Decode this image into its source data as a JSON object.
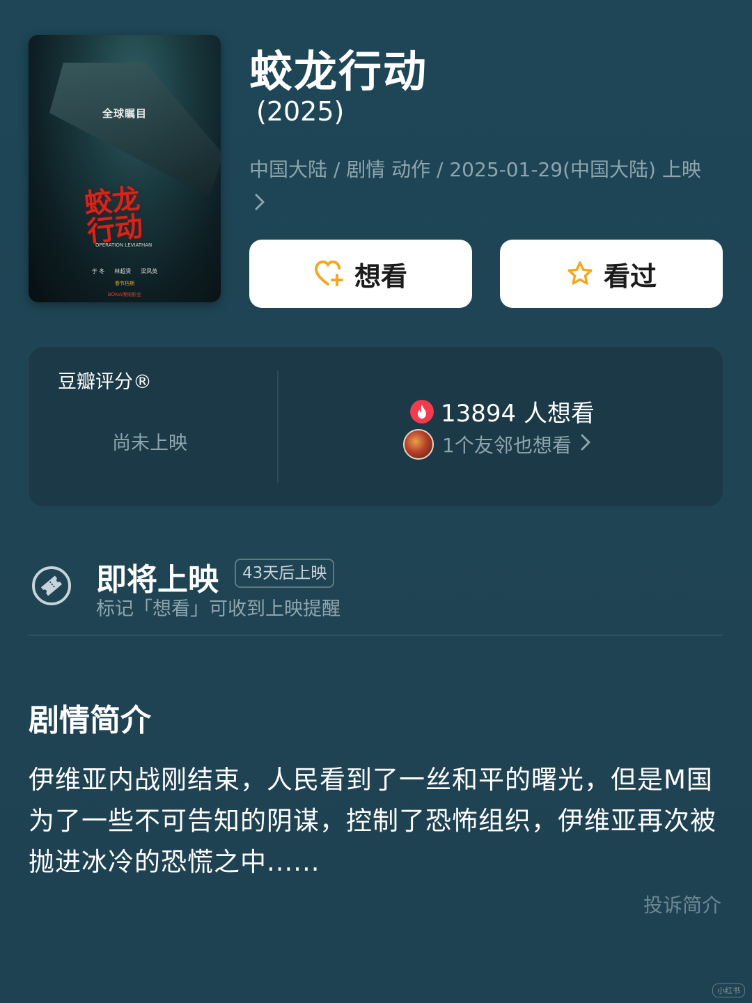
{
  "movie": {
    "title": "蛟龙行动",
    "year": "(2025)",
    "meta_line": "中国大陆 / 剧情 动作 / 2025-01-29(中国大陆) 上映",
    "poster": {
      "subtitle": "全球瞩目",
      "logo_text": "蛟龙行动",
      "english_title": "OPERATION LEVIATHAN",
      "cast": [
        "于 冬",
        "林超贤",
        "梁凤英"
      ],
      "tagline": "春节档期",
      "studio": "BONA博纳影业"
    }
  },
  "actions": {
    "want_label": "想看",
    "seen_label": "看过"
  },
  "rating": {
    "label": "豆瓣评分®",
    "status": "尚未上映",
    "want_count_text": "13894 人想看",
    "friends_text": "1个友邻也想看"
  },
  "upcoming": {
    "title": "即将上映",
    "days_badge": "43天后上映",
    "hint": "标记「想看」可收到上映提醒"
  },
  "synopsis": {
    "title": "剧情简介",
    "text": "伊维亚内战刚结束，人民看到了一丝和平的曙光，但是M国为了一些不可告知的阴谋，控制了恐怖组织，伊维亚再次被抛进冰冷的恐慌之中......",
    "report_label": "投诉简介"
  },
  "watermark": "小红书",
  "colors": {
    "background": "#1f4555",
    "card": "#1b3947",
    "muted_text": "#8ea5ae",
    "accent_orange": "#f5a623",
    "fire_red": "#f23b4f"
  },
  "icons": [
    "heart-plus-icon",
    "star-icon",
    "fire-icon",
    "ticket-icon",
    "chevron-right-icon"
  ]
}
